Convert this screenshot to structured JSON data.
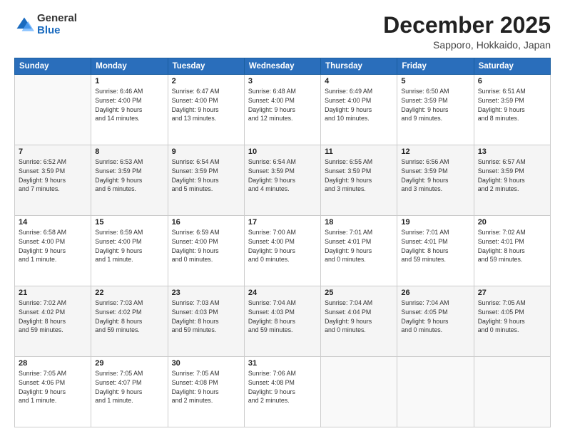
{
  "logo": {
    "general": "General",
    "blue": "Blue"
  },
  "header": {
    "month": "December 2025",
    "location": "Sapporo, Hokkaido, Japan"
  },
  "weekdays": [
    "Sunday",
    "Monday",
    "Tuesday",
    "Wednesday",
    "Thursday",
    "Friday",
    "Saturday"
  ],
  "weeks": [
    [
      {
        "day": "",
        "info": ""
      },
      {
        "day": "1",
        "info": "Sunrise: 6:46 AM\nSunset: 4:00 PM\nDaylight: 9 hours\nand 14 minutes."
      },
      {
        "day": "2",
        "info": "Sunrise: 6:47 AM\nSunset: 4:00 PM\nDaylight: 9 hours\nand 13 minutes."
      },
      {
        "day": "3",
        "info": "Sunrise: 6:48 AM\nSunset: 4:00 PM\nDaylight: 9 hours\nand 12 minutes."
      },
      {
        "day": "4",
        "info": "Sunrise: 6:49 AM\nSunset: 4:00 PM\nDaylight: 9 hours\nand 10 minutes."
      },
      {
        "day": "5",
        "info": "Sunrise: 6:50 AM\nSunset: 3:59 PM\nDaylight: 9 hours\nand 9 minutes."
      },
      {
        "day": "6",
        "info": "Sunrise: 6:51 AM\nSunset: 3:59 PM\nDaylight: 9 hours\nand 8 minutes."
      }
    ],
    [
      {
        "day": "7",
        "info": "Sunrise: 6:52 AM\nSunset: 3:59 PM\nDaylight: 9 hours\nand 7 minutes."
      },
      {
        "day": "8",
        "info": "Sunrise: 6:53 AM\nSunset: 3:59 PM\nDaylight: 9 hours\nand 6 minutes."
      },
      {
        "day": "9",
        "info": "Sunrise: 6:54 AM\nSunset: 3:59 PM\nDaylight: 9 hours\nand 5 minutes."
      },
      {
        "day": "10",
        "info": "Sunrise: 6:54 AM\nSunset: 3:59 PM\nDaylight: 9 hours\nand 4 minutes."
      },
      {
        "day": "11",
        "info": "Sunrise: 6:55 AM\nSunset: 3:59 PM\nDaylight: 9 hours\nand 3 minutes."
      },
      {
        "day": "12",
        "info": "Sunrise: 6:56 AM\nSunset: 3:59 PM\nDaylight: 9 hours\nand 3 minutes."
      },
      {
        "day": "13",
        "info": "Sunrise: 6:57 AM\nSunset: 3:59 PM\nDaylight: 9 hours\nand 2 minutes."
      }
    ],
    [
      {
        "day": "14",
        "info": "Sunrise: 6:58 AM\nSunset: 4:00 PM\nDaylight: 9 hours\nand 1 minute."
      },
      {
        "day": "15",
        "info": "Sunrise: 6:59 AM\nSunset: 4:00 PM\nDaylight: 9 hours\nand 1 minute."
      },
      {
        "day": "16",
        "info": "Sunrise: 6:59 AM\nSunset: 4:00 PM\nDaylight: 9 hours\nand 0 minutes."
      },
      {
        "day": "17",
        "info": "Sunrise: 7:00 AM\nSunset: 4:00 PM\nDaylight: 9 hours\nand 0 minutes."
      },
      {
        "day": "18",
        "info": "Sunrise: 7:01 AM\nSunset: 4:01 PM\nDaylight: 9 hours\nand 0 minutes."
      },
      {
        "day": "19",
        "info": "Sunrise: 7:01 AM\nSunset: 4:01 PM\nDaylight: 8 hours\nand 59 minutes."
      },
      {
        "day": "20",
        "info": "Sunrise: 7:02 AM\nSunset: 4:01 PM\nDaylight: 8 hours\nand 59 minutes."
      }
    ],
    [
      {
        "day": "21",
        "info": "Sunrise: 7:02 AM\nSunset: 4:02 PM\nDaylight: 8 hours\nand 59 minutes."
      },
      {
        "day": "22",
        "info": "Sunrise: 7:03 AM\nSunset: 4:02 PM\nDaylight: 8 hours\nand 59 minutes."
      },
      {
        "day": "23",
        "info": "Sunrise: 7:03 AM\nSunset: 4:03 PM\nDaylight: 8 hours\nand 59 minutes."
      },
      {
        "day": "24",
        "info": "Sunrise: 7:04 AM\nSunset: 4:03 PM\nDaylight: 8 hours\nand 59 minutes."
      },
      {
        "day": "25",
        "info": "Sunrise: 7:04 AM\nSunset: 4:04 PM\nDaylight: 9 hours\nand 0 minutes."
      },
      {
        "day": "26",
        "info": "Sunrise: 7:04 AM\nSunset: 4:05 PM\nDaylight: 9 hours\nand 0 minutes."
      },
      {
        "day": "27",
        "info": "Sunrise: 7:05 AM\nSunset: 4:05 PM\nDaylight: 9 hours\nand 0 minutes."
      }
    ],
    [
      {
        "day": "28",
        "info": "Sunrise: 7:05 AM\nSunset: 4:06 PM\nDaylight: 9 hours\nand 1 minute."
      },
      {
        "day": "29",
        "info": "Sunrise: 7:05 AM\nSunset: 4:07 PM\nDaylight: 9 hours\nand 1 minute."
      },
      {
        "day": "30",
        "info": "Sunrise: 7:05 AM\nSunset: 4:08 PM\nDaylight: 9 hours\nand 2 minutes."
      },
      {
        "day": "31",
        "info": "Sunrise: 7:06 AM\nSunset: 4:08 PM\nDaylight: 9 hours\nand 2 minutes."
      },
      {
        "day": "",
        "info": ""
      },
      {
        "day": "",
        "info": ""
      },
      {
        "day": "",
        "info": ""
      }
    ]
  ]
}
